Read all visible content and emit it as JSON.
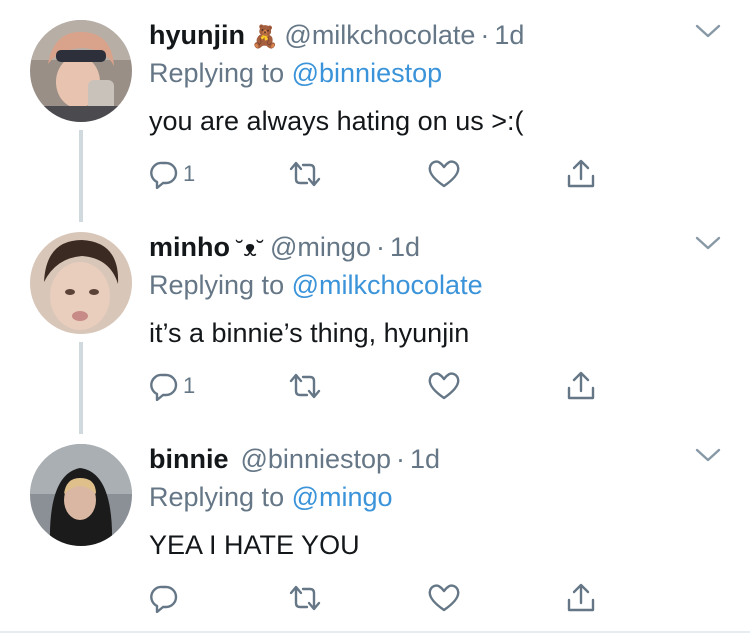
{
  "tweets": [
    {
      "name": "hyunjin",
      "emoji": "🧸",
      "handle": "@milkchocolate",
      "separator": "·",
      "time": "1d",
      "replying_prefix": "Replying to",
      "replying_to": "@binniestop",
      "text": "you are always hating on us >:(",
      "reply_count": "1",
      "avatar_colors": {
        "bg": "#9a8f87",
        "hair": "#d9a28a",
        "face": "#e8c4b0",
        "cap": "#2d2f3a"
      }
    },
    {
      "name": "minho",
      "emoji": "˘ᴥ˘",
      "handle": "@mingo",
      "separator": "·",
      "time": "1d",
      "replying_prefix": "Replying to",
      "replying_to": "@milkchocolate",
      "text": "it’s a binnie’s thing, hyunjin",
      "reply_count": "1",
      "avatar_colors": {
        "bg": "#d8c6b8",
        "hair": "#3a2a22",
        "face": "#e9cdbd",
        "cap": "#3a2a22"
      }
    },
    {
      "name": "binnie",
      "emoji": "",
      "handle": "@binniestop",
      "separator": "·",
      "time": "1d",
      "replying_prefix": "Replying to",
      "replying_to": "@mingo",
      "text": "YEA I HATE YOU",
      "reply_count": "",
      "avatar_colors": {
        "bg": "#8a9096",
        "hair": "#141414",
        "face": "#d9b7a3",
        "cap": "#1b1b1b"
      }
    }
  ],
  "icons": {
    "reply": "reply-icon",
    "retweet": "retweet-icon",
    "like": "heart-icon",
    "share": "share-icon",
    "more": "chevron-down-icon"
  },
  "colors": {
    "text": "#14171a",
    "secondary": "#657786",
    "link": "#3b94d9",
    "thread_line": "#cfd9de"
  }
}
